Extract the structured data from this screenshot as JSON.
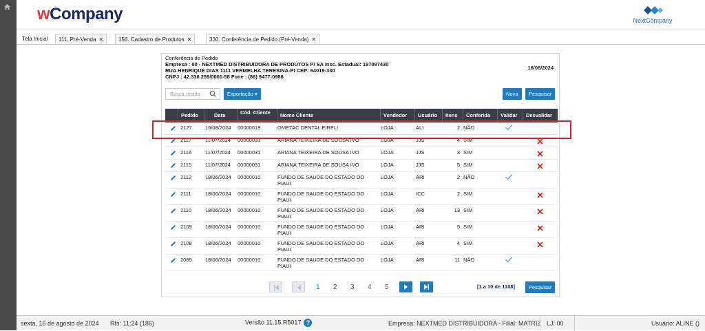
{
  "header": {
    "logo_w": "w",
    "logo_rest": "Company",
    "brand_right": "NextCompany"
  },
  "tabs": [
    {
      "label": "Tela Inicial",
      "closable": false
    },
    {
      "label": "111. Pré-Venda",
      "closable": true
    },
    {
      "label": "156. Cadastro de Produtos",
      "closable": true
    },
    {
      "label": "330. Conferência de Pedido (Pré-Venda)",
      "closable": true
    }
  ],
  "close_glyph": "✕",
  "panel": {
    "title": "Conferência de Pedido",
    "empresa": "Empresa : 00 - NEXTMED DISTRIBUIDORA DE PRODUTOS P/ SA Insc. Estadual: 197097430",
    "endereco": "RUA HENRIQUE DIAS 1111 VERMELHA TERESINA-PI CEP: 64019-330",
    "cnpj": "CNPJ : 42.336.259/0001-58 Fone : (86) 9477-0988",
    "date": "16/08/2024",
    "search_placeholder": "Busca rápida",
    "export_label": "Exportação",
    "nova_label": "Nova",
    "pesquisar_label": "Pesquisar"
  },
  "columns": [
    "Pedido",
    "Data",
    "Cód. Cliente",
    "Nome Cliente",
    "Vendedor",
    "Usuário",
    "Itens",
    "Conferida",
    "Validar",
    "Desvalidar"
  ],
  "rows": [
    {
      "pedido": "2127",
      "data": "16/08/2024",
      "cod": "00000019",
      "nome": "OMETAC DENTAL EIRELI",
      "vendedor": "LOJA",
      "usuario": "ALI",
      "itens": "2",
      "conferida": "NÃO",
      "validar": true,
      "desvalidar": false
    },
    {
      "pedido": "2117",
      "data": "11/07/2024",
      "cod": "00000031",
      "nome": "ARIANA TEIXEIRA DE SOUSA IVO",
      "vendedor": "LOJA",
      "usuario": "JJS",
      "itens": "4",
      "conferida": "SIM",
      "validar": false,
      "desvalidar": true
    },
    {
      "pedido": "2116",
      "data": "11/07/2024",
      "cod": "00000031",
      "nome": "ARIANA TEIXEIRA DE SOUSA IVO",
      "vendedor": "LOJA",
      "usuario": "JJS",
      "itens": "3",
      "conferida": "SIM",
      "validar": false,
      "desvalidar": true
    },
    {
      "pedido": "2115",
      "data": "11/07/2024",
      "cod": "00000031",
      "nome": "ARIANA TEIXEIRA DE SOUSA IVO",
      "vendedor": "LOJA",
      "usuario": "JJS",
      "itens": "5",
      "conferida": "SIM",
      "validar": false,
      "desvalidar": true
    },
    {
      "pedido": "2112",
      "data": "18/06/2024",
      "cod": "00000010",
      "nome": "FUNDO DE SAUDE DO ESTADO DO PIAUI",
      "vendedor": "LOJA",
      "usuario": "ARI",
      "itens": "2",
      "conferida": "NÃO",
      "validar": true,
      "desvalidar": false
    },
    {
      "pedido": "2111",
      "data": "18/06/2024",
      "cod": "00000010",
      "nome": "FUNDO DE SAUDE DO ESTADO DO PIAUI",
      "vendedor": "LOJA",
      "usuario": "ICC",
      "itens": "2",
      "conferida": "SIM",
      "validar": false,
      "desvalidar": true
    },
    {
      "pedido": "2110",
      "data": "18/06/2024",
      "cod": "00000010",
      "nome": "FUNDO DE SAUDE DO ESTADO DO PIAUI",
      "vendedor": "LOJA",
      "usuario": "ARI",
      "itens": "13",
      "conferida": "SIM",
      "validar": false,
      "desvalidar": true
    },
    {
      "pedido": "2109",
      "data": "18/06/2024",
      "cod": "00000010",
      "nome": "FUNDO DE SAUDE DO ESTADO DO PIAUI",
      "vendedor": "LOJA",
      "usuario": "ARI",
      "itens": "5",
      "conferida": "SIM",
      "validar": false,
      "desvalidar": true
    },
    {
      "pedido": "2108",
      "data": "18/06/2024",
      "cod": "00000010",
      "nome": "FUNDO DE SAUDE DO ESTADO DO PIAUI",
      "vendedor": "LOJA",
      "usuario": "ARI",
      "itens": "4",
      "conferida": "SIM",
      "validar": false,
      "desvalidar": true
    },
    {
      "pedido": "2089",
      "data": "18/06/2024",
      "cod": "00000010",
      "nome": "FUNDO DE SAUDE DO ESTADO DO PIAUI",
      "vendedor": "LOJA",
      "usuario": "ARI",
      "itens": "11",
      "conferida": "NÃO",
      "validar": true,
      "desvalidar": false
    }
  ],
  "pager": {
    "pages": [
      "1",
      "2",
      "3",
      "4",
      "5"
    ],
    "current": "1",
    "count_text": "[1 a 10 de 1108]",
    "pesquisar_label": "Pesquisar"
  },
  "status": {
    "date_text": "sexta, 16 de agosto de 2024",
    "rfs_text": "Rfs: 11:24 (186)",
    "version_text": "Versão 11.15.R5017",
    "help_glyph": "?",
    "empresa_text": "Empresa: NEXTMED DISTRIBUIDORA - Filial: MATRIZ",
    "lj_text": "LJ: 00",
    "usuario_text": "Usuário: ALINE ()"
  },
  "colors": {
    "accent": "#1c7cc4",
    "header_dark": "#3a3f47",
    "check": "#4aa3d6",
    "cross": "#d8232a",
    "highlight": "#d8232a"
  }
}
